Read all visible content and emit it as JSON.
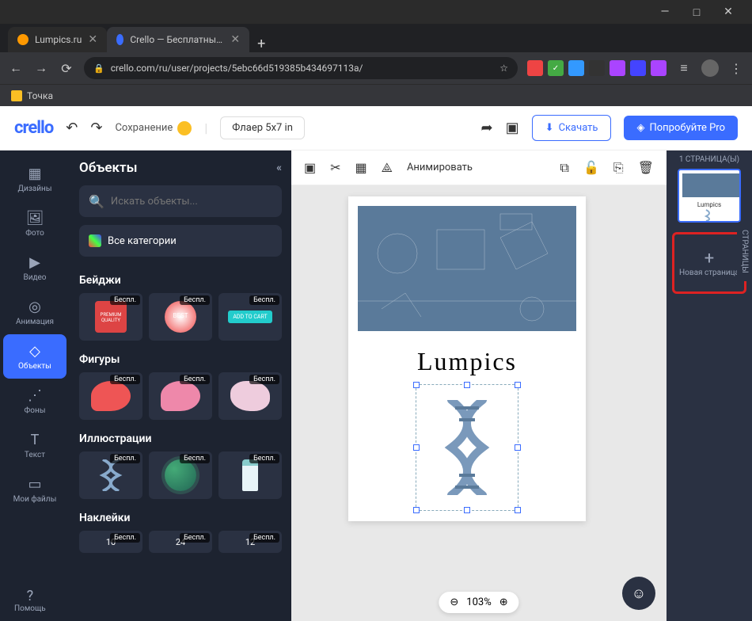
{
  "browser": {
    "tabs": [
      {
        "title": "Lumpics.ru",
        "active": false
      },
      {
        "title": "Crello — Бесплатный инструмен",
        "active": true
      }
    ],
    "url": "crello.com/ru/user/projects/5ebc66d519385b434697113a/",
    "bookmark": "Точка"
  },
  "topbar": {
    "logo": "crello",
    "saving": "Сохранение",
    "doctype": "Флаер 5x7  in",
    "download": "Скачать",
    "pro": "Попробуйте Pro"
  },
  "rail": [
    {
      "label": "Дизайны",
      "icon": "⊞"
    },
    {
      "label": "Фото",
      "icon": "🖼"
    },
    {
      "label": "Видео",
      "icon": "▶"
    },
    {
      "label": "Анимация",
      "icon": "◎"
    },
    {
      "label": "Объекты",
      "icon": "◇"
    },
    {
      "label": "Фоны",
      "icon": "⋰"
    },
    {
      "label": "Текст",
      "icon": "T"
    },
    {
      "label": "Мои файлы",
      "icon": "▭"
    }
  ],
  "panel": {
    "title": "Объекты",
    "search_ph": "Искать объекты...",
    "categories": "Все категории",
    "sections": {
      "badges": "Бейджи",
      "shapes": "Фигуры",
      "illustrations": "Иллюстрации",
      "stickers": "Наклейки"
    },
    "free": "Беспл.",
    "badge_labels": [
      "PREMIUM QUALITY",
      "BEST",
      "ADD TO CART"
    ],
    "sticker_nums": [
      "10",
      "24",
      "12"
    ]
  },
  "canvas": {
    "toolbar": {
      "animate": "Анимировать"
    },
    "text": "Lumpics",
    "zoom": "103%"
  },
  "pages": {
    "header": "1 СТРАНИЦА(Ы)",
    "new": "Новая страница",
    "vtab": "СТРАНИЦЫ"
  },
  "help": "Помощь"
}
